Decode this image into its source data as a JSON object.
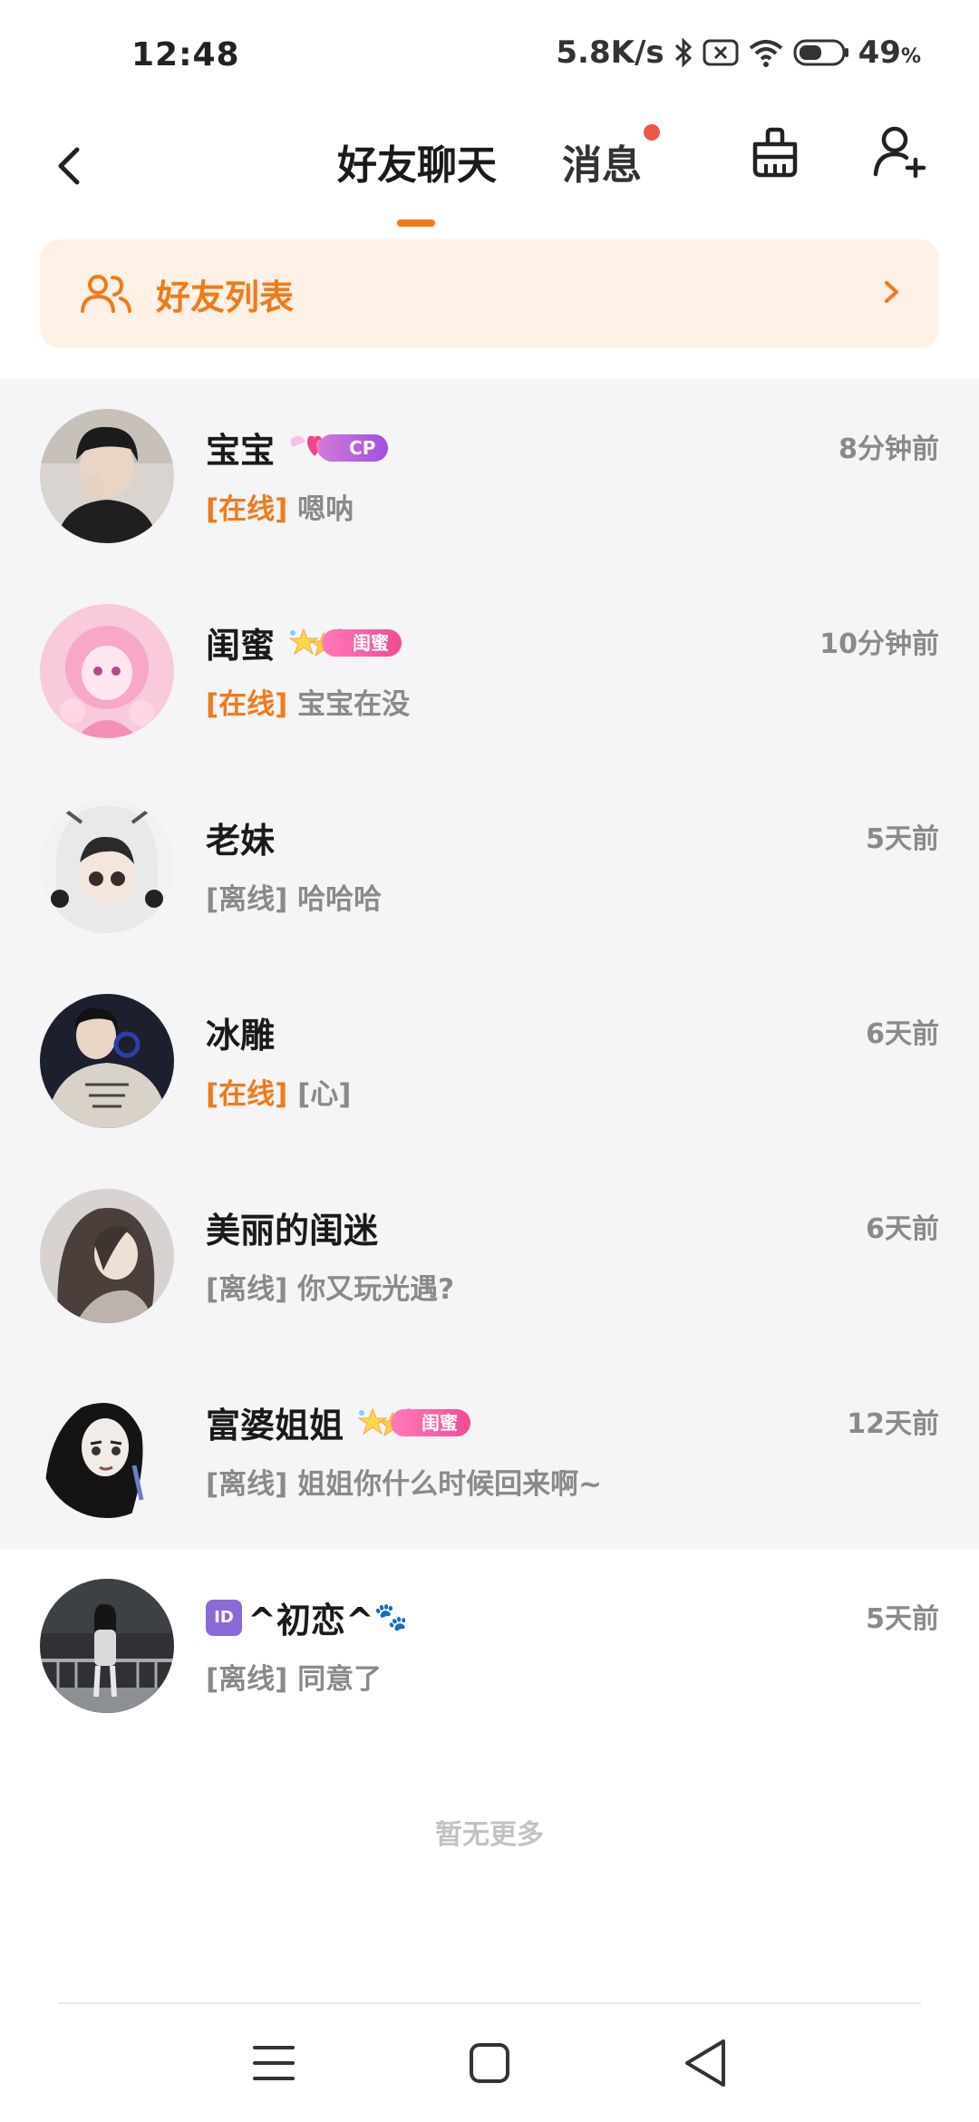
{
  "status_bar": {
    "time": "12:48",
    "net_speed": "5.8K/s",
    "battery": "49",
    "battery_unit": "%",
    "icons": [
      "bluetooth-icon",
      "screen-close-icon",
      "wifi-icon",
      "battery-icon"
    ]
  },
  "header": {
    "tab_chat": "好友聊天",
    "tab_messages": "消息",
    "icons": [
      "back-icon",
      "clean-basket-icon",
      "add-friend-icon"
    ],
    "accent_color": "#f07a1a",
    "dot_color": "#f0554a"
  },
  "friends_banner": {
    "label": "好友列表",
    "icons": [
      "friends-icon",
      "chevron-right-icon"
    ],
    "bg_color": "#fff1e5"
  },
  "chats": [
    {
      "name": "宝宝",
      "badge": "CP",
      "status": "[在线]",
      "online": true,
      "preview": "嗯呐",
      "time": "8分钟前"
    },
    {
      "name": "闺蜜",
      "badge": "闺蜜",
      "status": "[在线]",
      "online": true,
      "preview": "宝宝在没",
      "time": "10分钟前"
    },
    {
      "name": "老妹",
      "status": "[离线]",
      "online": false,
      "preview": "哈哈哈",
      "time": "5天前"
    },
    {
      "name": "冰雕",
      "status": "[在线]",
      "online": true,
      "preview": "[心]",
      "time": "6天前"
    },
    {
      "name": "美丽的闺迷",
      "status": "[离线]",
      "online": false,
      "preview": "你又玩光遇?",
      "time": "6天前"
    },
    {
      "name": "富婆姐姐",
      "badge": "闺蜜",
      "status": "[离线]",
      "online": false,
      "preview": "姐姐你什么时候回来啊~",
      "time": "12天前"
    },
    {
      "name_prefix": "ID",
      "name": "^初恋^",
      "name_suffix": "🐾",
      "status": "[离线]",
      "online": false,
      "preview": "同意了",
      "time": "5天前"
    }
  ],
  "no_more": "暂无更多",
  "nav": {
    "icons": [
      "menu-icon",
      "home-icon",
      "back-triangle-icon"
    ]
  }
}
